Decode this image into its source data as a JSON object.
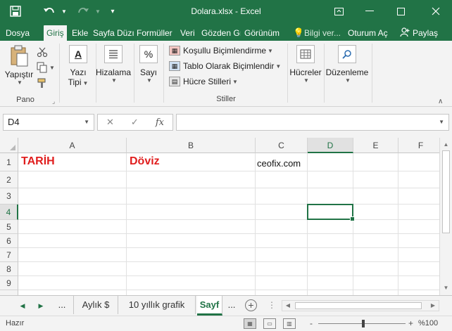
{
  "window": {
    "title": "Dolara.xlsx - Excel",
    "qat": {
      "save_icon": "save-icon",
      "undo_icon": "undo-icon",
      "redo_icon": "redo-icon"
    }
  },
  "tabs": [
    {
      "label": "Dosya"
    },
    {
      "label": "Giriş"
    },
    {
      "label": "Ekle"
    },
    {
      "label": "Sayfa Düzı"
    },
    {
      "label": "Formüller"
    },
    {
      "label": "Veri"
    },
    {
      "label": "Gözden Gı"
    },
    {
      "label": "Görünüm"
    }
  ],
  "tell_me": "Bilgi ver...",
  "sign_in": "Oturum Aç",
  "share": "Paylaş",
  "ribbon": {
    "clipboard": {
      "paste": "Yapıştır",
      "label": "Pano"
    },
    "font": {
      "line1": "Yazı",
      "line2": "Tipi"
    },
    "alignment": {
      "label": "Hizalama"
    },
    "number": {
      "label": "Sayı"
    },
    "styles": {
      "conditional": "Koşullu Biçimlendirme",
      "as_table": "Tablo Olarak Biçimlendir",
      "cell_styles": "Hücre Stilleri",
      "label": "Stiller"
    },
    "cells": {
      "label": "Hücreler"
    },
    "editing": {
      "label": "Düzenleme"
    }
  },
  "formula_bar": {
    "name_box": "D4",
    "cancel": "✕",
    "enter": "✓",
    "fx": "fx",
    "value": ""
  },
  "grid": {
    "columns": [
      "A",
      "B",
      "C",
      "D",
      "E",
      "F"
    ],
    "rows": [
      "1",
      "2",
      "3",
      "4",
      "5",
      "6",
      "7",
      "8",
      "9"
    ],
    "cells": {
      "A1": "TARİH",
      "B1": "Döviz",
      "C1": "ceofix.com"
    },
    "selected": "D4",
    "text_color": "#e01e1e"
  },
  "sheets": {
    "ellipsis_left": "...",
    "tabs": [
      {
        "label": "Aylık $"
      },
      {
        "label": "10 yıllık grafik"
      },
      {
        "label": "Sayf"
      }
    ],
    "ellipsis_right": "..."
  },
  "status": {
    "ready": "Hazır",
    "zoom": "%100",
    "zoom_minus": "-",
    "zoom_plus": "+"
  },
  "colors": {
    "accent": "#217346"
  }
}
